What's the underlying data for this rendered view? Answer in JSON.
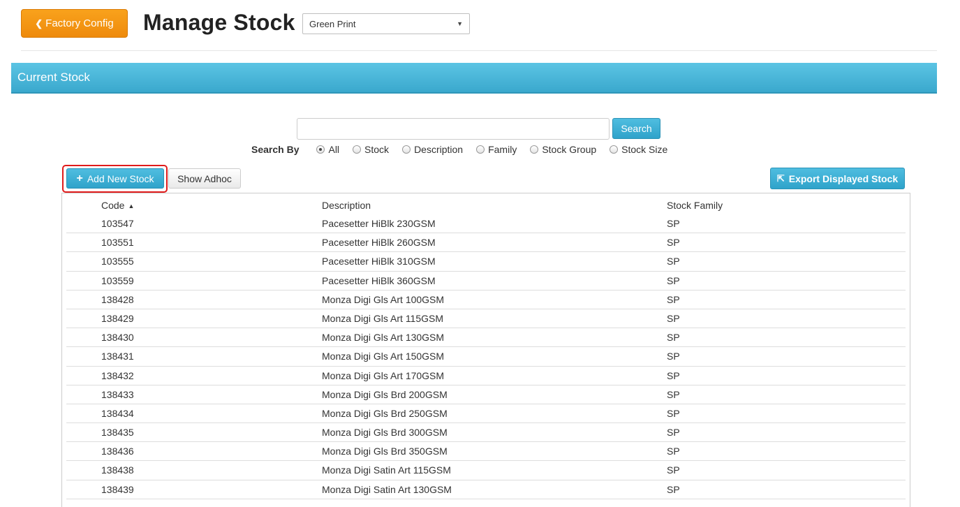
{
  "header": {
    "back_label": "Factory Config",
    "title": "Manage Stock",
    "site_select": "Green Print"
  },
  "panel": {
    "title": "Current Stock"
  },
  "search": {
    "input_value": "",
    "button_label": "Search",
    "by_label": "Search By",
    "options": [
      "All",
      "Stock",
      "Description",
      "Family",
      "Stock Group",
      "Stock Size"
    ],
    "selected": "All"
  },
  "toolbar": {
    "add_label": "Add New Stock",
    "adhoc_label": "Show Adhoc",
    "export_label": "Export Displayed Stock"
  },
  "table": {
    "columns": [
      "Code",
      "Description",
      "Stock Family"
    ],
    "sort_column": "Code",
    "sort_dir": "asc",
    "rows": [
      [
        "103547",
        "Pacesetter HiBlk 230GSM",
        "SP"
      ],
      [
        "103551",
        "Pacesetter HiBlk 260GSM",
        "SP"
      ],
      [
        "103555",
        "Pacesetter HiBlk 310GSM",
        "SP"
      ],
      [
        "103559",
        "Pacesetter HiBlk 360GSM",
        "SP"
      ],
      [
        "138428",
        "Monza Digi Gls Art 100GSM",
        "SP"
      ],
      [
        "138429",
        "Monza Digi Gls Art 115GSM",
        "SP"
      ],
      [
        "138430",
        "Monza Digi Gls Art 130GSM",
        "SP"
      ],
      [
        "138431",
        "Monza Digi Gls Art 150GSM",
        "SP"
      ],
      [
        "138432",
        "Monza Digi Gls Art 170GSM",
        "SP"
      ],
      [
        "138433",
        "Monza Digi Gls Brd 200GSM",
        "SP"
      ],
      [
        "138434",
        "Monza Digi Gls Brd 250GSM",
        "SP"
      ],
      [
        "138435",
        "Monza Digi Gls Brd 300GSM",
        "SP"
      ],
      [
        "138436",
        "Monza Digi Gls Brd 350GSM",
        "SP"
      ],
      [
        "138438",
        "Monza Digi Satin Art 115GSM",
        "SP"
      ],
      [
        "138439",
        "Monza Digi Satin Art 130GSM",
        "SP"
      ]
    ]
  },
  "colors": {
    "accent_orange": "#f39c12",
    "accent_blue": "#3aa8cd",
    "highlight_red": "#e01b1b"
  }
}
